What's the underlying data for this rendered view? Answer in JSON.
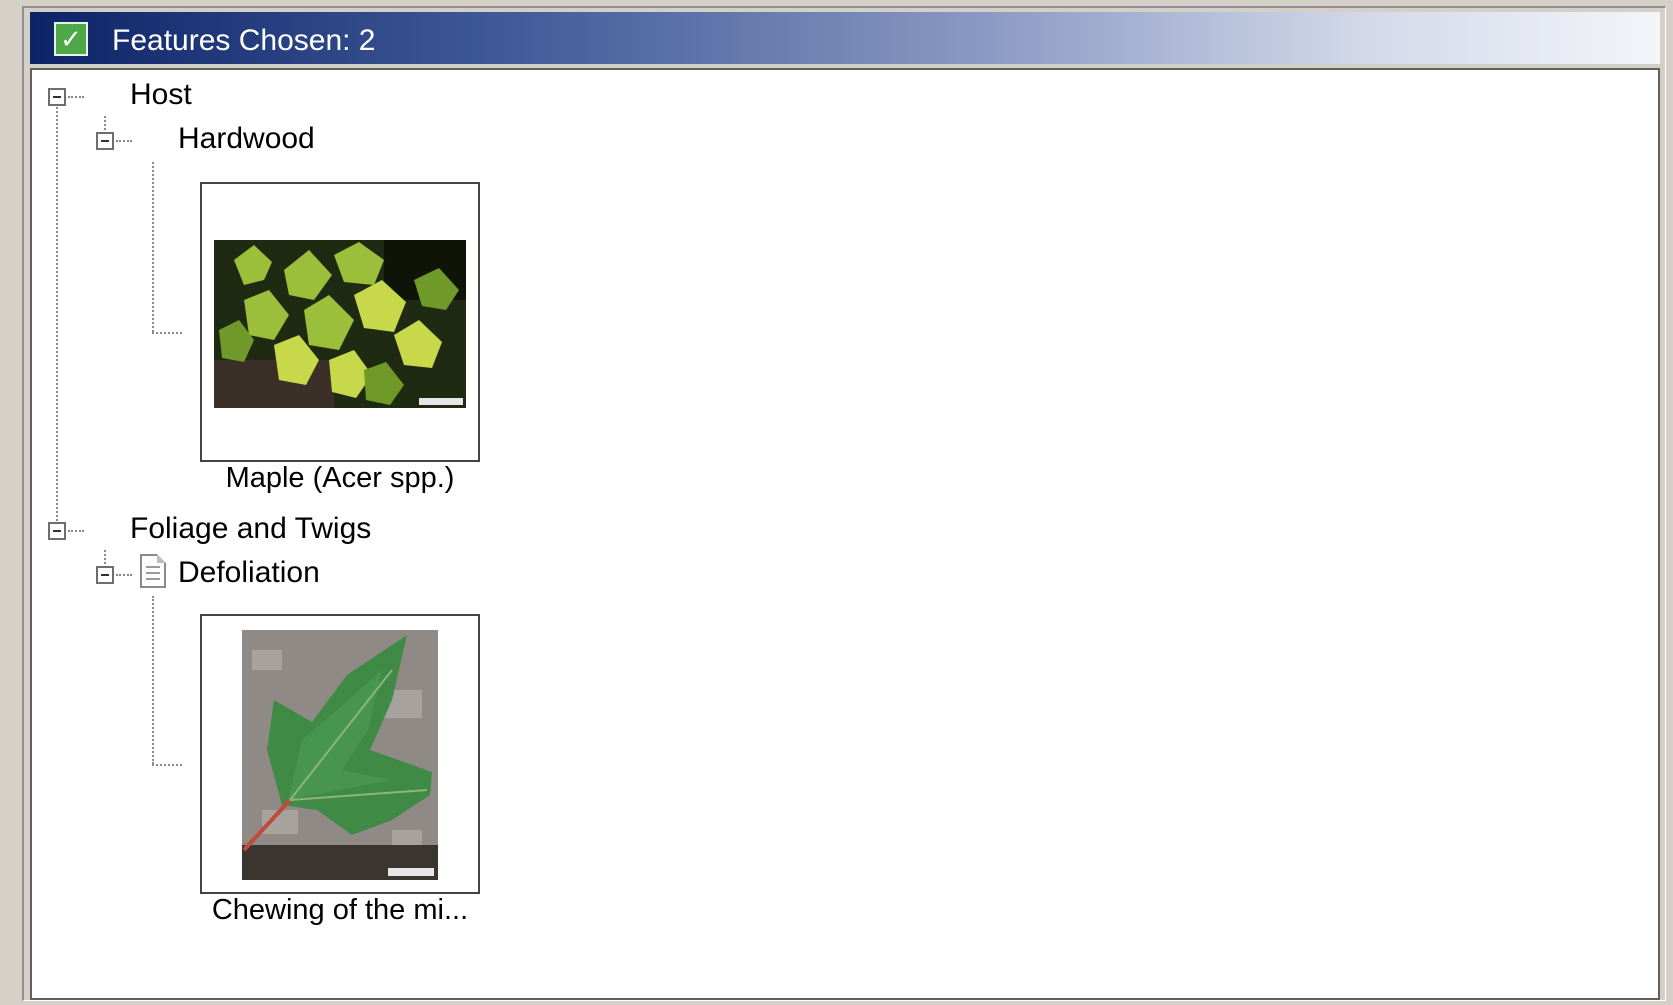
{
  "header": {
    "icon": "checkbox-checked-icon",
    "title": "Features Chosen: 2"
  },
  "tree": {
    "nodes": [
      {
        "label": "Host",
        "children": [
          {
            "label": "Hardwood",
            "thumbnail": {
              "caption": "Maple (Acer spp.)",
              "image": "maple-foliage-photo"
            }
          }
        ]
      },
      {
        "label": "Foliage and Twigs",
        "children": [
          {
            "label": "Defoliation",
            "icon": "document-icon",
            "thumbnail": {
              "caption": "Chewing of the mi...",
              "image": "maple-leaf-photo"
            }
          }
        ]
      }
    ]
  },
  "colors": {
    "header_gradient_start": "#0c2466",
    "header_gradient_end": "#f4f5f9",
    "panel_bg": "#d4d0c8",
    "tree_bg": "#ffffff"
  }
}
